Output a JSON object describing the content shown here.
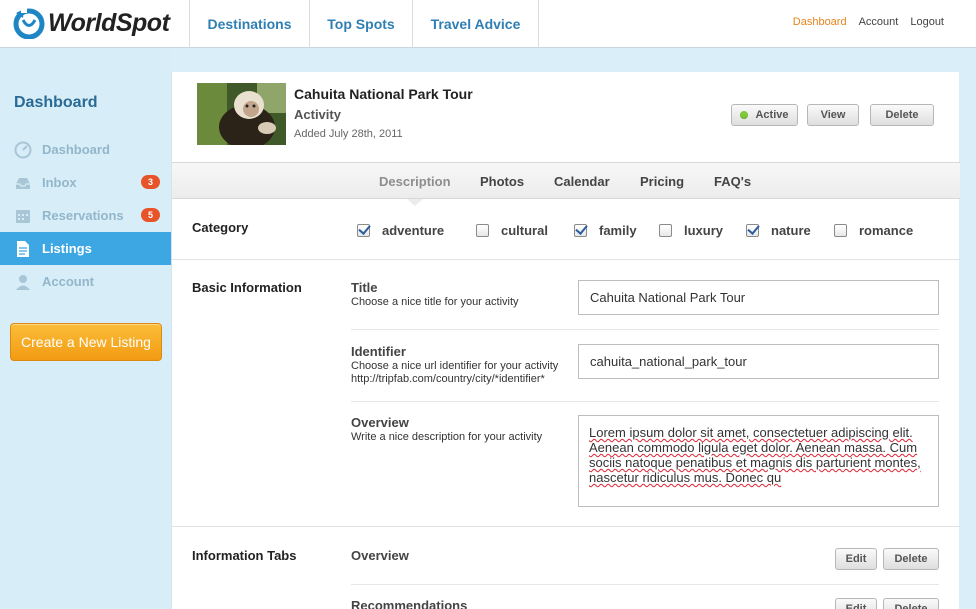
{
  "brand": {
    "name": "WorldSpot"
  },
  "nav": {
    "items": [
      "Destinations",
      "Top Spots",
      "Travel Advice"
    ],
    "right": [
      "Dashboard",
      "Account",
      "Logout"
    ]
  },
  "sidebar": {
    "title": "Dashboard",
    "items": [
      {
        "label": "Dashboard",
        "icon": "dashboard-gauge-icon"
      },
      {
        "label": "Inbox",
        "icon": "inbox-tray-icon",
        "badge": "3"
      },
      {
        "label": "Reservations",
        "icon": "calendar-icon",
        "badge": "5"
      },
      {
        "label": "Listings",
        "icon": "document-icon",
        "active": true
      },
      {
        "label": "Account",
        "icon": "user-icon"
      }
    ],
    "create_button": "Create a New Listing"
  },
  "listing": {
    "title": "Cahuita National Park Tour",
    "type": "Activity",
    "added": "Added July 28th, 2011",
    "status_button": "Active",
    "view_button": "View",
    "delete_button": "Delete"
  },
  "tabs": [
    "Description",
    "Photos",
    "Calendar",
    "Pricing",
    "FAQ's"
  ],
  "category": {
    "label": "Category",
    "options": [
      {
        "label": "adventure",
        "checked": true
      },
      {
        "label": "cultural",
        "checked": false
      },
      {
        "label": "family",
        "checked": true
      },
      {
        "label": "luxury",
        "checked": false
      },
      {
        "label": "nature",
        "checked": true
      },
      {
        "label": "romance",
        "checked": false
      }
    ]
  },
  "basic_info": {
    "label": "Basic Information",
    "title_field": {
      "label": "Title",
      "help": "Choose a nice title for your activity",
      "value": "Cahuita National Park Tour"
    },
    "identifier_field": {
      "label": "Identifier",
      "help": "Choose a nice url identifier for your activity",
      "help2": "http://tripfab.com/country/city/*identifier*",
      "value": "cahuita_national_park_tour"
    },
    "overview_field": {
      "label": "Overview",
      "help": "Write a nice description for your activity",
      "value": "Lorem ipsum dolor sit amet, consectetuer adipiscing elit. Aenean commodo ligula eget dolor. Aenean massa. Cum sociis natoque penatibus et magnis dis parturient montes, nascetur ridiculus mus. Donec qu"
    }
  },
  "info_tabs": {
    "label": "Information Tabs",
    "items": [
      "Overview",
      "Recommendations"
    ],
    "edit_button": "Edit",
    "delete_button": "Delete"
  },
  "colors": {
    "accent_blue": "#3da7e4",
    "brand_orange": "#f29b12",
    "badge_red": "#e8542a",
    "active_green": "#7dc93a"
  }
}
